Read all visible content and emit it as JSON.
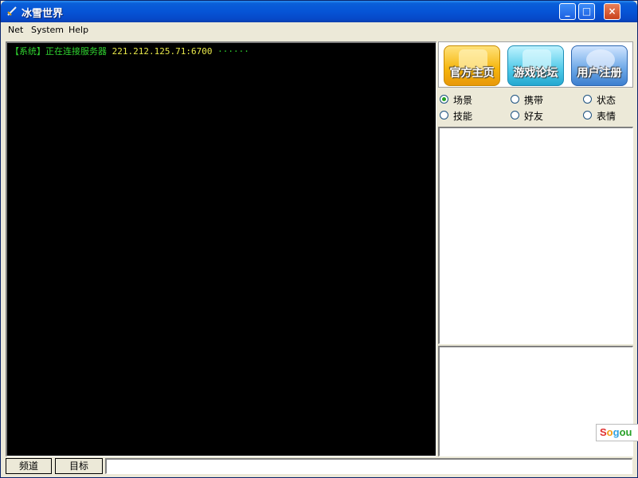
{
  "window": {
    "title": "冰雪世界",
    "controls": {
      "minimize": "_",
      "maximize": "□",
      "close": "×"
    }
  },
  "menu": [
    "Net",
    "System",
    "Help"
  ],
  "console": {
    "lines": [
      {
        "tag": "【系统】",
        "message": "正在连接服务器",
        "address": "221.212.125.71:6700",
        "trail": "······"
      }
    ]
  },
  "links": [
    {
      "label": "官方主页",
      "icon": "home-box-icon"
    },
    {
      "label": "游戏论坛",
      "icon": "forum-cards-icon"
    },
    {
      "label": "用户注册",
      "icon": "globe-user-icon"
    }
  ],
  "tabs": {
    "options": [
      "场景",
      "携带",
      "状态",
      "技能",
      "好友",
      "表情"
    ],
    "selected": "场景"
  },
  "ime": {
    "text": [
      "S",
      "o",
      "g",
      "ou"
    ],
    "suffix": ""
  },
  "statusbar": {
    "channel_label": "频道",
    "target_label": "目标",
    "input_value": ""
  },
  "colors": {
    "console_bg": "#000000",
    "console_system": "#2fd22f",
    "console_address": "#e8e84a",
    "titlebar": "#0654d6"
  }
}
